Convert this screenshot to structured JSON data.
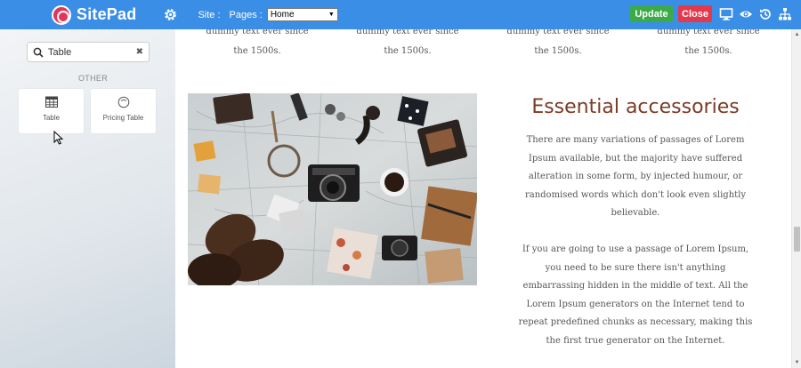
{
  "header": {
    "brand": "SitePad",
    "site_label": "Site :",
    "pages_label": "Pages :",
    "pages_selected": "Home",
    "update_label": "Update",
    "close_label": "Close",
    "icons": [
      "gear-icon",
      "desktop-preview-icon",
      "eye-icon",
      "history-icon",
      "sitemap-icon"
    ],
    "colors": {
      "bar": "#3a8ee6",
      "update": "#3bab4a",
      "close": "#e4394c"
    }
  },
  "sidebar": {
    "search_value": "Table",
    "section": "OTHER",
    "widgets": [
      {
        "label": "Table",
        "icon": "table-icon"
      },
      {
        "label": "Pricing Table",
        "icon": "pricing-table-icon"
      }
    ]
  },
  "content": {
    "columns": [
      {
        "line1": "dummy text ever since",
        "line2": "the 1500s."
      },
      {
        "line1": "dummy text ever since",
        "line2": "the 1500s."
      },
      {
        "line1": "dummy text ever since",
        "line2": "the 1500s."
      },
      {
        "line1": "dummy text ever since",
        "line2": "the 1500s."
      }
    ],
    "heading": "Essential accessories",
    "para1": [
      "There are many variations of passages of Lorem",
      "Ipsum available, but the majority have suffered",
      "alteration in some form, by injected humour, or",
      "randomised words which don't look even slightly",
      "believable."
    ],
    "para2": [
      "If you are going to use a passage of Lorem Ipsum,",
      "you need to be sure there isn't anything",
      "embarrassing hidden in the middle of text. All the",
      "Lorem Ipsum generators on the Internet tend to",
      "repeat predefined chunks as necessary, making this",
      "the first true generator on the Internet."
    ],
    "heading_color": "#7b3b26"
  }
}
